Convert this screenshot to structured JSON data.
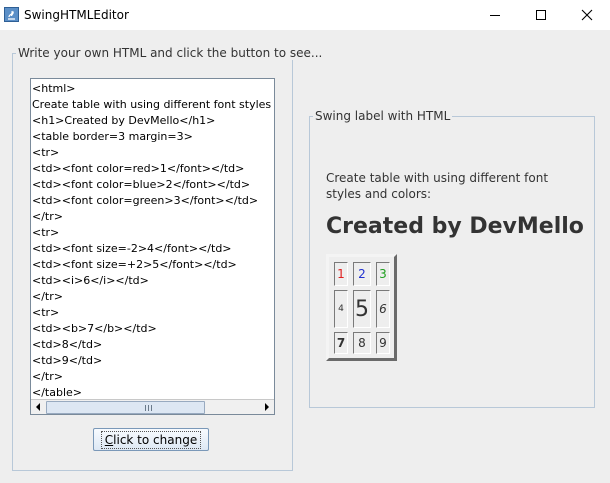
{
  "window": {
    "title": "SwingHTMLEditor",
    "controls": [
      "minimize-icon",
      "maximize-icon",
      "close-icon"
    ]
  },
  "editor_panel": {
    "title": "Write your own HTML and click the button to see...",
    "lines": [
      "<html>",
      "Create table with using different font styles and colors:",
      "<h1>Created by DevMello</h1>",
      "<table border=3 margin=3>",
      "<tr>",
      "<td><font color=red>1</font></td>",
      "<td><font color=blue>2</font></td>",
      "<td><font color=green>3</font></td>",
      "</tr>",
      "<tr>",
      "<td><font size=-2>4</font></td>",
      "<td><font size=+2>5</font></td>",
      "<td><i>6</i></td>",
      "</tr>",
      "<tr>",
      "<td><b>7</b></td>",
      "<td>8</td>",
      "<td>9</td>",
      "</tr>",
      "</table>"
    ],
    "button_label": "Click to change"
  },
  "preview_panel": {
    "title": "Swing label with HTML",
    "description": "Create table with using different font styles and colors:",
    "heading": "Created by DevMello",
    "cells": [
      {
        "text": "1",
        "color": "#e02020",
        "style": "normal",
        "size": "normal"
      },
      {
        "text": "2",
        "color": "#2030d0",
        "style": "normal",
        "size": "normal"
      },
      {
        "text": "3",
        "color": "#20a020",
        "style": "normal",
        "size": "normal"
      },
      {
        "text": "4",
        "color": "#333333",
        "style": "normal",
        "size": "small"
      },
      {
        "text": "5",
        "color": "#333333",
        "style": "normal",
        "size": "large"
      },
      {
        "text": "6",
        "color": "#333333",
        "style": "italic",
        "size": "normal"
      },
      {
        "text": "7",
        "color": "#333333",
        "style": "bold",
        "size": "normal"
      },
      {
        "text": "8",
        "color": "#333333",
        "style": "normal",
        "size": "normal"
      },
      {
        "text": "9",
        "color": "#333333",
        "style": "normal",
        "size": "normal"
      }
    ]
  }
}
